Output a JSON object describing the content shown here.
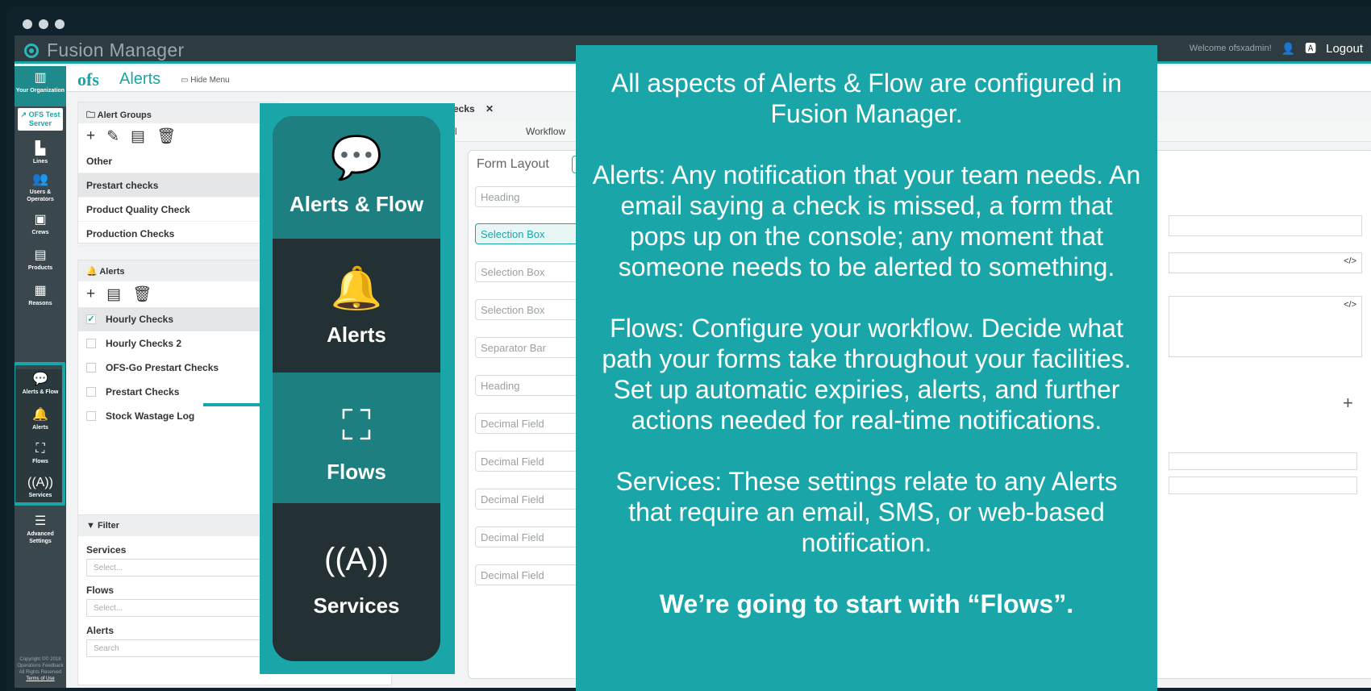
{
  "header": {
    "app_title": "Fusion Manager",
    "welcome": "Welcome ofsxadmin!",
    "logout": "Logout"
  },
  "subheader": {
    "logo": "ofs",
    "title": "Alerts",
    "hide_menu": "Hide Menu"
  },
  "nav": {
    "items": [
      {
        "label": "Your Organization",
        "icon": "building-icon"
      },
      {
        "label": "OFS Test Server",
        "icon": "external-link-icon"
      },
      {
        "label": "Lines",
        "icon": "chart-icon"
      },
      {
        "label": "Users & Operators",
        "icon": "users-icon"
      },
      {
        "label": "Crews",
        "icon": "crew-icon"
      },
      {
        "label": "Products",
        "icon": "archive-icon"
      },
      {
        "label": "Reasons",
        "icon": "book-icon"
      },
      {
        "label": "Alerts & Flow",
        "icon": "chat-icon"
      },
      {
        "label": "Alerts",
        "icon": "bell-icon"
      },
      {
        "label": "Flows",
        "icon": "sitemap-icon"
      },
      {
        "label": "Services",
        "icon": "antenna-icon"
      },
      {
        "label": "Advanced Settings",
        "icon": "sliders-icon"
      }
    ],
    "footer": "Copyright ©© 2018 Operations Feedback All Rights Reserved",
    "terms": "Terms of Use"
  },
  "alert_groups": {
    "title": "Alert Groups",
    "rows": [
      "Other",
      "Prestart checks",
      "Product Quality Check",
      "Production Checks"
    ]
  },
  "alerts": {
    "title": "Alerts",
    "rows": [
      "Hourly Checks",
      "Hourly Checks 2",
      "OFS-Go Prestart Checks",
      "Prestart Checks",
      "Stock Wastage Log"
    ]
  },
  "filter": {
    "title": "Filter",
    "services_label": "Services",
    "services_placeholder": "Select...",
    "flows_label": "Flows",
    "flows_placeholder": "Select...",
    "alerts_label": "Alerts",
    "alerts_placeholder": "Search"
  },
  "center": {
    "tab": "Checks",
    "tab_close": "✕",
    "subtab_left": "l",
    "subtab_workflow": "Workflow",
    "form_title": "Form Layout",
    "fields": [
      "Heading",
      "Selection Box",
      "Selection Box",
      "Selection Box",
      "Separator Bar",
      "Heading",
      "Decimal Field",
      "Decimal Field",
      "Decimal Field",
      "Decimal Field",
      "Decimal Field"
    ]
  },
  "zoom": {
    "items": [
      {
        "label": "Alerts & Flow",
        "icon": "chat-icon"
      },
      {
        "label": "Alerts",
        "icon": "bell-icon"
      },
      {
        "label": "Flows",
        "icon": "sitemap-icon"
      },
      {
        "label": "Services",
        "icon": "antenna-icon"
      }
    ]
  },
  "overlay": {
    "p1": "All aspects of Alerts & Flow are configured in Fusion Manager.",
    "p2": "Alerts: Any notification that your team needs. An email saying a check is missed, a form that pops up on the console; any moment that someone needs to be alerted to something.",
    "p3": "Flows: Configure your workflow. Decide what path your forms take throughout your facilities. Set up automatic expiries, alerts, and further actions needed for real-time notifications.",
    "p4": "Services: These settings relate to any Alerts that require an email, SMS, or web-based notification.",
    "p5": "We’re going to start with “Flows”."
  },
  "colors": {
    "accent": "#1aa6a8",
    "nav_bg": "#3a474c",
    "header_bg": "#2e3b40"
  }
}
